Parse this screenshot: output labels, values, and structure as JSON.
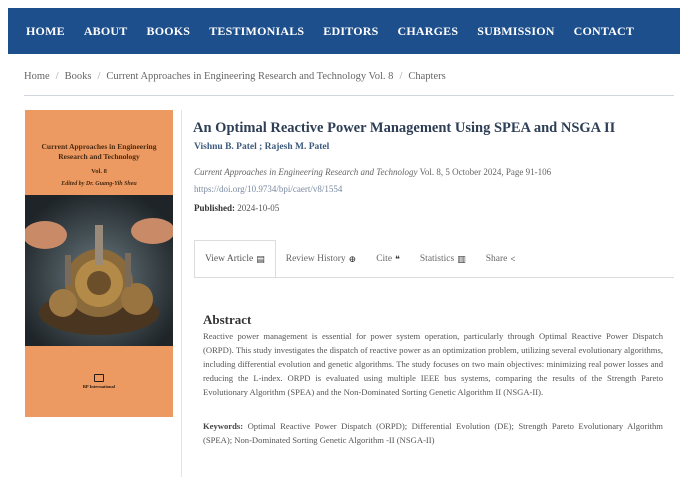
{
  "nav": {
    "items": [
      "HOME",
      "ABOUT",
      "BOOKS",
      "TESTIMONIALS",
      "EDITORS",
      "CHARGES",
      "SUBMISSION",
      "CONTACT"
    ]
  },
  "breadcrumb": {
    "items": [
      "Home",
      "Books",
      "Current Approaches in Engineering Research and Technology Vol. 8",
      "Chapters"
    ],
    "separator": "/"
  },
  "cover": {
    "title": "Current Approaches in Engineering Research and Technology",
    "volume": "Vol. 8",
    "editor": "Edited by Dr. Guang-Yih Sheu",
    "publisher": "BP International",
    "background_color": "#ec9a62"
  },
  "article": {
    "title": "An Optimal Reactive Power Management Using SPEA and NSGA II",
    "authors": "Vishnu B. Patel ;  Rajesh M. Patel",
    "book": "Current Approaches in Engineering Research and Technology",
    "meta_rest": " Vol. 8, 5 October 2024, Page 91-106",
    "doi": "https://doi.org/10.9734/bpi/caert/v8/1554",
    "published_label": "Published:",
    "published_date": "2024-10-05"
  },
  "tabs": [
    {
      "label": "View Article",
      "icon": "document-icon",
      "glyph": "▤",
      "active": true
    },
    {
      "label": "Review History",
      "icon": "globe-icon",
      "glyph": "⊕",
      "active": false
    },
    {
      "label": "Cite",
      "icon": "quote-icon",
      "glyph": "❝",
      "active": false
    },
    {
      "label": "Statistics",
      "icon": "chart-icon",
      "glyph": "▥",
      "active": false
    },
    {
      "label": "Share",
      "icon": "share-icon",
      "glyph": "<",
      "active": false
    }
  ],
  "abstract": {
    "heading": "Abstract",
    "body": "Reactive power management is essential for power system operation, particularly through Optimal Reactive Power Dispatch (ORPD). This study investigates the dispatch of reactive power as an optimization problem, utilizing several evolutionary algorithms, including differential evolution and genetic algorithms. The study focuses on two main objectives: minimizing real power losses and reducing the L-index. ORPD is evaluated using multiple IEEE bus systems, comparing the results of the Strength Pareto Evolutionary Algorithm (SPEA) and the Non-Dominated Sorting Genetic Algorithm II (NSGA-II).",
    "keywords_label": "Keywords:",
    "keywords": "Optimal Reactive Power Dispatch (ORPD);  Differential Evolution (DE);  Strength Pareto Evolutionary Algorithm (SPEA);  Non-Dominated Sorting Genetic Algorithm -II (NSGA-II)"
  },
  "colors": {
    "nav_bg": "#1d4f8c",
    "title": "#2d3e55",
    "author": "#3d5a7d"
  }
}
